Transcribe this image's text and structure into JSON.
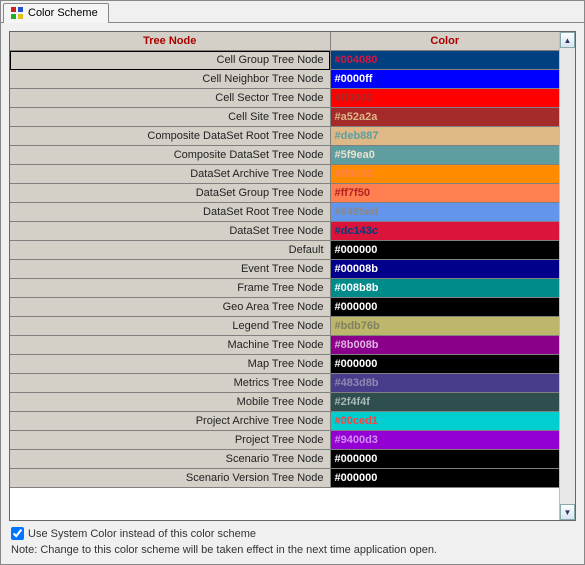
{
  "tab": {
    "label": "Color Scheme"
  },
  "table": {
    "headers": {
      "node": "Tree Node",
      "color": "Color"
    },
    "rows": [
      {
        "name": "Cell Group Tree Node",
        "hex": "#004080",
        "text": "#dc143c",
        "selected": true
      },
      {
        "name": "Cell Neighbor Tree Node",
        "hex": "#0000ff",
        "text": "#ffffff"
      },
      {
        "name": "Cell Sector Tree Node",
        "hex": "#ff0000",
        "text": "#a52a2a"
      },
      {
        "name": "Cell Site Tree Node",
        "hex": "#a52a2a",
        "text": "#deb887"
      },
      {
        "name": "Composite DataSet Root Tree Node",
        "hex": "#deb887",
        "text": "#5f9ea0"
      },
      {
        "name": "Composite DataSet Tree Node",
        "hex": "#5f9ea0",
        "text": "#e8e1d0"
      },
      {
        "name": "DataSet Archive Tree Node",
        "hex": "#ff8c00",
        "text": "#ff7f50"
      },
      {
        "name": "DataSet Group Tree Node",
        "hex": "#ff7f50",
        "text": "#b22222"
      },
      {
        "name": "DataSet Root Tree Node",
        "hex": "#6495ed",
        "text": "#888888"
      },
      {
        "name": "DataSet Tree Node",
        "hex": "#dc143c",
        "text": "#004080"
      },
      {
        "name": "Default",
        "hex": "#000000",
        "text": "#ffffff"
      },
      {
        "name": "Event Tree Node",
        "hex": "#00008b",
        "text": "#ffffff"
      },
      {
        "name": "Frame Tree Node",
        "hex": "#008b8b",
        "text": "#ffffff"
      },
      {
        "name": "Geo Area Tree Node",
        "hex": "#000000",
        "text": "#ffffff"
      },
      {
        "name": "Legend Tree Node",
        "hex": "#bdb76b",
        "text": "#808060"
      },
      {
        "name": "Machine Tree Node",
        "hex": "#8b008b",
        "text": "#e0b0e0"
      },
      {
        "name": "Map Tree Node",
        "hex": "#000000",
        "text": "#ffffff"
      },
      {
        "name": "Metrics Tree Node",
        "hex": "#483d8b",
        "text": "#9088b0"
      },
      {
        "name": "Mobile Tree Node",
        "hex": "#2f4f4f",
        "text": "#aab8b8"
      },
      {
        "name": "Project Archive Tree Node",
        "hex": "#00ced1",
        "text": "#ff4040"
      },
      {
        "name": "Project Tree Node",
        "hex": "#9400d3",
        "text": "#d090f0"
      },
      {
        "name": "Scenario Tree Node",
        "hex": "#000000",
        "text": "#ffffff"
      },
      {
        "name": "Scenario Version Tree Node",
        "hex": "#000000",
        "text": "#ffffff"
      }
    ]
  },
  "footer": {
    "checkbox_label": "Use System Color instead of this color scheme",
    "checkbox_checked": true,
    "note": "Note: Change to this color scheme will be taken effect in the next time application open."
  }
}
